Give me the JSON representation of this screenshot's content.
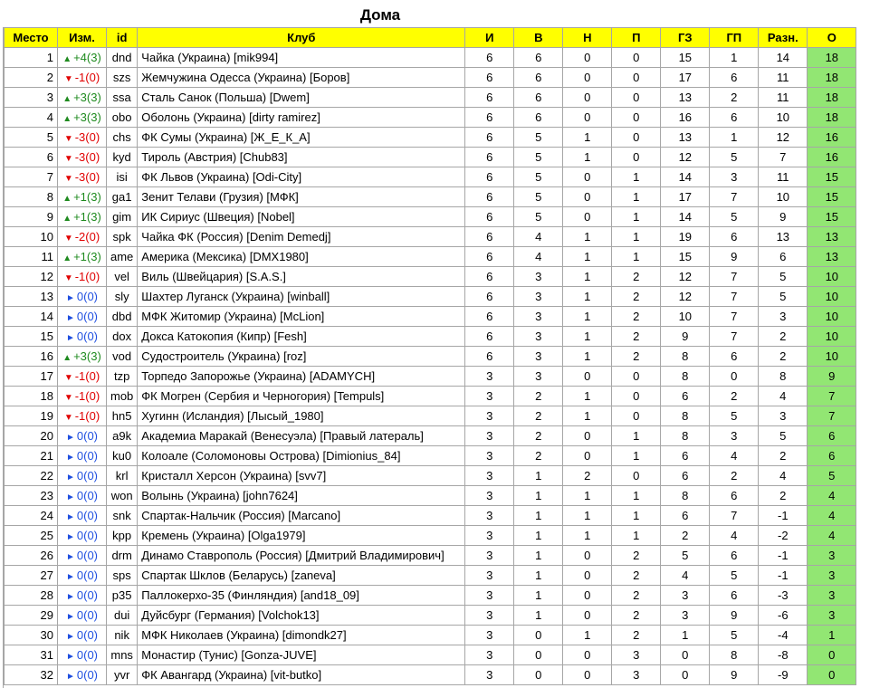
{
  "title": "Дома",
  "headers": [
    "Место",
    "Изм.",
    "id",
    "Клуб",
    "И",
    "В",
    "Н",
    "П",
    "ГЗ",
    "ГП",
    "Разн.",
    "О"
  ],
  "colors": {
    "header_bg": "#ffff00",
    "points_bg": "#92e673",
    "up": "#1e8a1e",
    "down": "#e00000",
    "same": "#1f4fe0"
  },
  "rows": [
    {
      "place": "1",
      "dir": "up",
      "change": "+4(3)",
      "id": "dnd",
      "club": "Чайка (Украина) [mik994]",
      "i": "6",
      "v": "6",
      "n": "0",
      "p": "0",
      "gz": "15",
      "gp": "1",
      "diff": "14",
      "pts": "18"
    },
    {
      "place": "2",
      "dir": "down",
      "change": "-1(0)",
      "id": "szs",
      "club": "Жемчужина Одесса (Украина) [Боров]",
      "i": "6",
      "v": "6",
      "n": "0",
      "p": "0",
      "gz": "17",
      "gp": "6",
      "diff": "11",
      "pts": "18"
    },
    {
      "place": "3",
      "dir": "up",
      "change": "+3(3)",
      "id": "ssa",
      "club": "Сталь Санок (Польша) [Dwem]",
      "i": "6",
      "v": "6",
      "n": "0",
      "p": "0",
      "gz": "13",
      "gp": "2",
      "diff": "11",
      "pts": "18"
    },
    {
      "place": "4",
      "dir": "up",
      "change": "+3(3)",
      "id": "obo",
      "club": "Оболонь (Украина) [dirty ramirez]",
      "i": "6",
      "v": "6",
      "n": "0",
      "p": "0",
      "gz": "16",
      "gp": "6",
      "diff": "10",
      "pts": "18"
    },
    {
      "place": "5",
      "dir": "down",
      "change": "-3(0)",
      "id": "chs",
      "club": "ФК Сумы (Украина) [Ж_Е_К_А]",
      "i": "6",
      "v": "5",
      "n": "1",
      "p": "0",
      "gz": "13",
      "gp": "1",
      "diff": "12",
      "pts": "16"
    },
    {
      "place": "6",
      "dir": "down",
      "change": "-3(0)",
      "id": "kyd",
      "club": "Тироль (Австрия) [Chub83]",
      "i": "6",
      "v": "5",
      "n": "1",
      "p": "0",
      "gz": "12",
      "gp": "5",
      "diff": "7",
      "pts": "16"
    },
    {
      "place": "7",
      "dir": "down",
      "change": "-3(0)",
      "id": "isi",
      "club": "ФК Львов (Украина) [Odi-City]",
      "i": "6",
      "v": "5",
      "n": "0",
      "p": "1",
      "gz": "14",
      "gp": "3",
      "diff": "11",
      "pts": "15"
    },
    {
      "place": "8",
      "dir": "up",
      "change": "+1(3)",
      "id": "ga1",
      "club": "Зенит Телави (Грузия) [МФК]",
      "i": "6",
      "v": "5",
      "n": "0",
      "p": "1",
      "gz": "17",
      "gp": "7",
      "diff": "10",
      "pts": "15"
    },
    {
      "place": "9",
      "dir": "up",
      "change": "+1(3)",
      "id": "gim",
      "club": "ИК Сириус (Швеция) [Nobel]",
      "i": "6",
      "v": "5",
      "n": "0",
      "p": "1",
      "gz": "14",
      "gp": "5",
      "diff": "9",
      "pts": "15"
    },
    {
      "place": "10",
      "dir": "down",
      "change": "-2(0)",
      "id": "spk",
      "club": "Чайка ФК (Россия) [Denim Demedj]",
      "i": "6",
      "v": "4",
      "n": "1",
      "p": "1",
      "gz": "19",
      "gp": "6",
      "diff": "13",
      "pts": "13"
    },
    {
      "place": "11",
      "dir": "up",
      "change": "+1(3)",
      "id": "ame",
      "club": "Америка (Мексика) [DMX1980]",
      "i": "6",
      "v": "4",
      "n": "1",
      "p": "1",
      "gz": "15",
      "gp": "9",
      "diff": "6",
      "pts": "13"
    },
    {
      "place": "12",
      "dir": "down",
      "change": "-1(0)",
      "id": "vel",
      "club": "Виль (Швейцария) [S.A.S.]",
      "i": "6",
      "v": "3",
      "n": "1",
      "p": "2",
      "gz": "12",
      "gp": "7",
      "diff": "5",
      "pts": "10"
    },
    {
      "place": "13",
      "dir": "same",
      "change": "0(0)",
      "id": "sly",
      "club": "Шахтер Луганск (Украина) [winball]",
      "i": "6",
      "v": "3",
      "n": "1",
      "p": "2",
      "gz": "12",
      "gp": "7",
      "diff": "5",
      "pts": "10"
    },
    {
      "place": "14",
      "dir": "same",
      "change": "0(0)",
      "id": "dbd",
      "club": "МФК Житомир (Украина) [McLion]",
      "i": "6",
      "v": "3",
      "n": "1",
      "p": "2",
      "gz": "10",
      "gp": "7",
      "diff": "3",
      "pts": "10"
    },
    {
      "place": "15",
      "dir": "same",
      "change": "0(0)",
      "id": "dox",
      "club": "Докса Катокопия (Кипр) [Fesh]",
      "i": "6",
      "v": "3",
      "n": "1",
      "p": "2",
      "gz": "9",
      "gp": "7",
      "diff": "2",
      "pts": "10"
    },
    {
      "place": "16",
      "dir": "up",
      "change": "+3(3)",
      "id": "vod",
      "club": "Судостроитель (Украина) [roz]",
      "i": "6",
      "v": "3",
      "n": "1",
      "p": "2",
      "gz": "8",
      "gp": "6",
      "diff": "2",
      "pts": "10"
    },
    {
      "place": "17",
      "dir": "down",
      "change": "-1(0)",
      "id": "tzp",
      "club": "Торпедо Запорожье (Украина) [ADAMYCH]",
      "i": "3",
      "v": "3",
      "n": "0",
      "p": "0",
      "gz": "8",
      "gp": "0",
      "diff": "8",
      "pts": "9"
    },
    {
      "place": "18",
      "dir": "down",
      "change": "-1(0)",
      "id": "mob",
      "club": "ФК Могрен (Сербия и Черногория) [Tempuls]",
      "i": "3",
      "v": "2",
      "n": "1",
      "p": "0",
      "gz": "6",
      "gp": "2",
      "diff": "4",
      "pts": "7"
    },
    {
      "place": "19",
      "dir": "down",
      "change": "-1(0)",
      "id": "hn5",
      "club": "Хугинн (Исландия) [Лысый_1980]",
      "i": "3",
      "v": "2",
      "n": "1",
      "p": "0",
      "gz": "8",
      "gp": "5",
      "diff": "3",
      "pts": "7"
    },
    {
      "place": "20",
      "dir": "same",
      "change": "0(0)",
      "id": "a9k",
      "club": "Академиа Маракай (Венесуэла) [Правый латераль]",
      "i": "3",
      "v": "2",
      "n": "0",
      "p": "1",
      "gz": "8",
      "gp": "3",
      "diff": "5",
      "pts": "6"
    },
    {
      "place": "21",
      "dir": "same",
      "change": "0(0)",
      "id": "ku0",
      "club": "Колоале (Соломоновы Острова) [Dimionius_84]",
      "i": "3",
      "v": "2",
      "n": "0",
      "p": "1",
      "gz": "6",
      "gp": "4",
      "diff": "2",
      "pts": "6"
    },
    {
      "place": "22",
      "dir": "same",
      "change": "0(0)",
      "id": "krl",
      "club": "Кристалл Херсон (Украина) [svv7]",
      "i": "3",
      "v": "1",
      "n": "2",
      "p": "0",
      "gz": "6",
      "gp": "2",
      "diff": "4",
      "pts": "5"
    },
    {
      "place": "23",
      "dir": "same",
      "change": "0(0)",
      "id": "won",
      "club": "Волынь (Украина) [john7624]",
      "i": "3",
      "v": "1",
      "n": "1",
      "p": "1",
      "gz": "8",
      "gp": "6",
      "diff": "2",
      "pts": "4"
    },
    {
      "place": "24",
      "dir": "same",
      "change": "0(0)",
      "id": "snk",
      "club": "Спартак-Нальчик (Россия) [Marcano]",
      "i": "3",
      "v": "1",
      "n": "1",
      "p": "1",
      "gz": "6",
      "gp": "7",
      "diff": "-1",
      "pts": "4"
    },
    {
      "place": "25",
      "dir": "same",
      "change": "0(0)",
      "id": "kpp",
      "club": "Кремень (Украина) [Olga1979]",
      "i": "3",
      "v": "1",
      "n": "1",
      "p": "1",
      "gz": "2",
      "gp": "4",
      "diff": "-2",
      "pts": "4"
    },
    {
      "place": "26",
      "dir": "same",
      "change": "0(0)",
      "id": "drm",
      "club": "Динамо Ставрополь (Россия) [Дмитрий Владимирович]",
      "i": "3",
      "v": "1",
      "n": "0",
      "p": "2",
      "gz": "5",
      "gp": "6",
      "diff": "-1",
      "pts": "3"
    },
    {
      "place": "27",
      "dir": "same",
      "change": "0(0)",
      "id": "sps",
      "club": "Спартак Шклов (Беларусь) [zaneva]",
      "i": "3",
      "v": "1",
      "n": "0",
      "p": "2",
      "gz": "4",
      "gp": "5",
      "diff": "-1",
      "pts": "3"
    },
    {
      "place": "28",
      "dir": "same",
      "change": "0(0)",
      "id": "p35",
      "club": "Паллокерхо-35 (Финляндия) [and18_09]",
      "i": "3",
      "v": "1",
      "n": "0",
      "p": "2",
      "gz": "3",
      "gp": "6",
      "diff": "-3",
      "pts": "3"
    },
    {
      "place": "29",
      "dir": "same",
      "change": "0(0)",
      "id": "dui",
      "club": "Дуйсбург (Германия) [Volchok13]",
      "i": "3",
      "v": "1",
      "n": "0",
      "p": "2",
      "gz": "3",
      "gp": "9",
      "diff": "-6",
      "pts": "3"
    },
    {
      "place": "30",
      "dir": "same",
      "change": "0(0)",
      "id": "nik",
      "club": "МФК Николаев (Украина) [dimondk27]",
      "i": "3",
      "v": "0",
      "n": "1",
      "p": "2",
      "gz": "1",
      "gp": "5",
      "diff": "-4",
      "pts": "1"
    },
    {
      "place": "31",
      "dir": "same",
      "change": "0(0)",
      "id": "mns",
      "club": "Монастир (Тунис) [Gonza-JUVE]",
      "i": "3",
      "v": "0",
      "n": "0",
      "p": "3",
      "gz": "0",
      "gp": "8",
      "diff": "-8",
      "pts": "0"
    },
    {
      "place": "32",
      "dir": "same",
      "change": "0(0)",
      "id": "yvr",
      "club": "ФК Авангард (Украина) [vit-butko]",
      "i": "3",
      "v": "0",
      "n": "0",
      "p": "3",
      "gz": "0",
      "gp": "9",
      "diff": "-9",
      "pts": "0"
    }
  ]
}
